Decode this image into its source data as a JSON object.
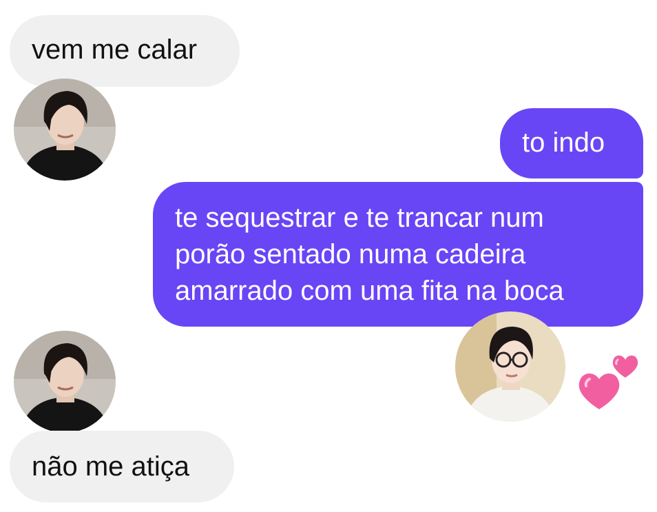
{
  "chat": {
    "messages": [
      {
        "sender": "contact",
        "text": "vem me calar"
      },
      {
        "sender": "me",
        "text": "to indo"
      },
      {
        "sender": "me",
        "lines": [
          "te sequestrar e te trancar num",
          "porão sentado numa cadeira",
          "amarrado com uma fita na boca"
        ]
      },
      {
        "sender": "contact",
        "text": "não me atiça"
      }
    ],
    "reaction_emoji": "two-hearts-icon"
  },
  "colors": {
    "incoming_bubble": "#f0f0f0",
    "outgoing_bubble": "#6846f5",
    "heart_pink": "#f25fa0"
  }
}
